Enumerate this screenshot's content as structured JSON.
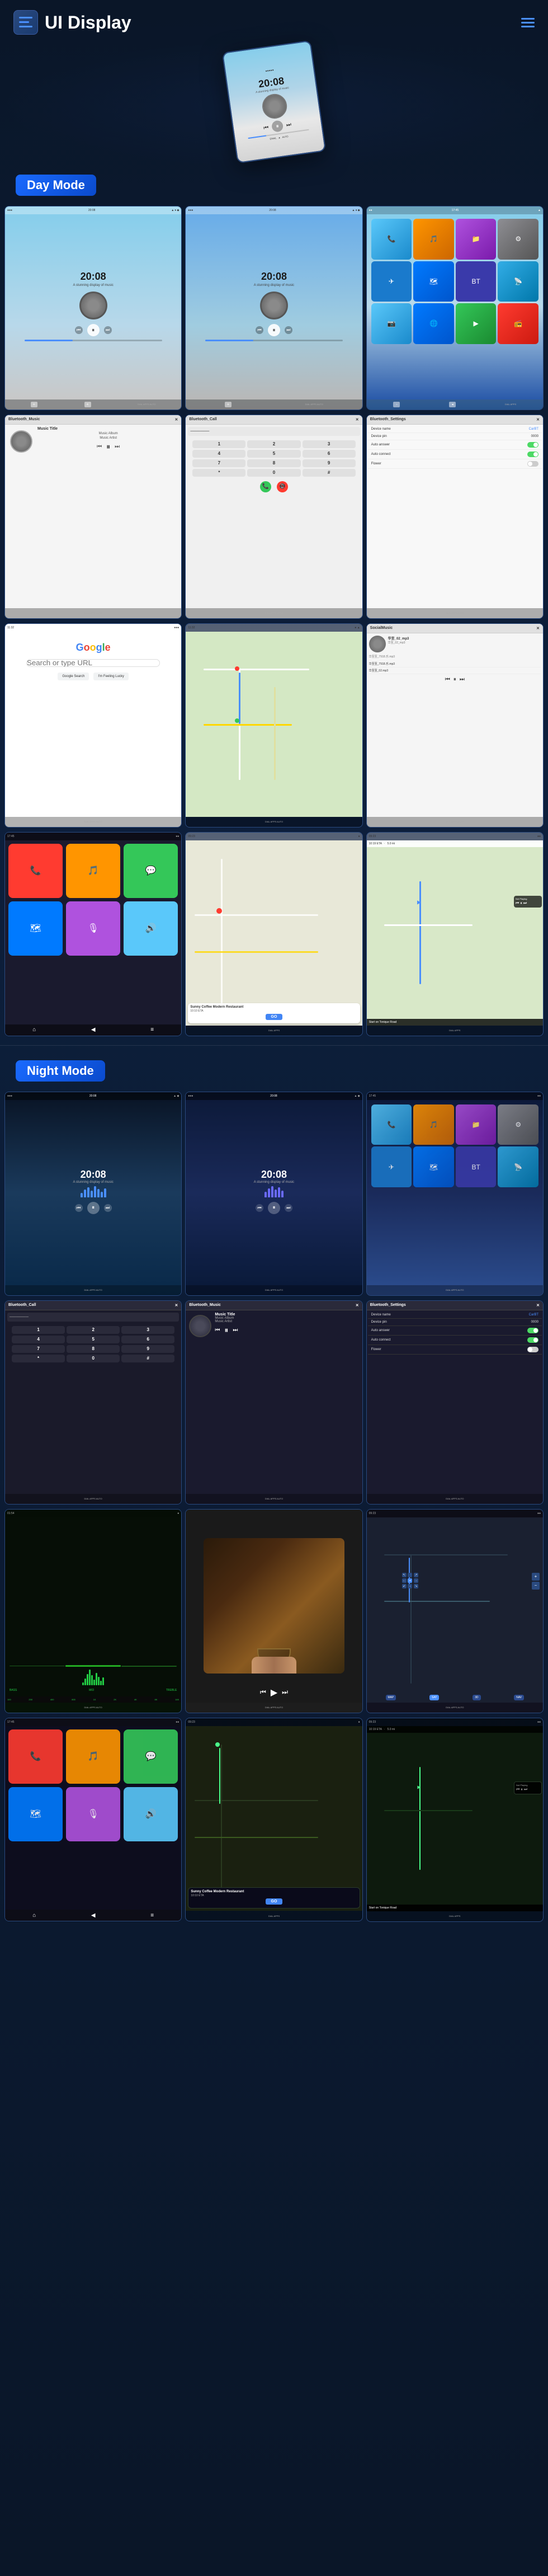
{
  "header": {
    "title": "UI Display",
    "menu_icon": "menu-icon",
    "dots_icon": "dots-icon"
  },
  "hero": {
    "time": "20:08",
    "subtitle": "A stunning display of music"
  },
  "sections": {
    "day_mode_label": "Day Mode",
    "night_mode_label": "Night Mode"
  },
  "day_mode": {
    "row1": [
      {
        "id": "music-day-1",
        "type": "music",
        "bg": "day_blue",
        "time": "20:08",
        "subtitle": "A stunning display of music"
      },
      {
        "id": "music-day-2",
        "type": "music",
        "bg": "day_blue2",
        "time": "20:08",
        "subtitle": "A stunning display of music"
      },
      {
        "id": "apps-day",
        "type": "apps",
        "bg": "day_apps"
      }
    ],
    "row2": [
      {
        "id": "bt-music",
        "type": "bt_music",
        "header": "Bluetooth_Music",
        "title": "Music Title",
        "album": "Music Album",
        "artist": "Music Artist"
      },
      {
        "id": "bt-call",
        "type": "bt_call",
        "header": "Bluetooth_Call"
      },
      {
        "id": "bt-settings",
        "type": "bt_settings",
        "header": "Bluetooth_Settings",
        "device_name_label": "Device name",
        "device_name_val": "CarBT",
        "device_pin_label": "Device pin",
        "device_pin_val": "0000",
        "auto_answer_label": "Auto answer",
        "auto_connect_label": "Auto connect",
        "flower_label": "Flower"
      }
    ],
    "row3": [
      {
        "id": "google",
        "type": "google"
      },
      {
        "id": "map-day",
        "type": "map"
      },
      {
        "id": "local-music",
        "type": "local_music"
      }
    ],
    "row4": [
      {
        "id": "carplay-apps",
        "type": "carplay_apps"
      },
      {
        "id": "nav-day",
        "type": "navigation",
        "restaurant": "Sunny Coffee Modern Restaurant",
        "distance": "10:10 ETA",
        "go_label": "GO"
      },
      {
        "id": "nav-map-day",
        "type": "nav_map",
        "eta": "10:19 ETA",
        "distance": "5.0 mi",
        "direction": "Start on Tonique Road",
        "now_playing": "Not Playing"
      }
    ]
  },
  "night_mode": {
    "row1": [
      {
        "id": "music-night-1",
        "type": "music_night",
        "time": "20:08",
        "subtitle": "A stunning display of music"
      },
      {
        "id": "music-night-2",
        "type": "music_night2",
        "time": "20:08",
        "subtitle": "A stunning display of music"
      },
      {
        "id": "apps-night",
        "type": "apps_night"
      }
    ],
    "row2": [
      {
        "id": "bt-call-night",
        "type": "bt_call_night",
        "header": "Bluetooth_Call"
      },
      {
        "id": "bt-music-night",
        "type": "bt_music_night",
        "header": "Bluetooth_Music",
        "title": "Music Title",
        "album": "Music Album",
        "artist": "Music Artist"
      },
      {
        "id": "bt-settings-night",
        "type": "bt_settings_night",
        "header": "Bluetooth_Settings",
        "device_name_label": "Device name",
        "device_name_val": "CarBT",
        "device_pin_label": "Device pin",
        "device_pin_val": "0000",
        "auto_answer_label": "Auto answer",
        "auto_connect_label": "Auto connect",
        "flower_label": "Flower"
      }
    ],
    "row3": [
      {
        "id": "green-wave",
        "type": "green_wave"
      },
      {
        "id": "hand-bowl",
        "type": "hand_bowl"
      },
      {
        "id": "dark-map",
        "type": "dark_map"
      }
    ],
    "row4": [
      {
        "id": "carplay-night",
        "type": "carplay_night"
      },
      {
        "id": "nav-night",
        "type": "nav_night",
        "restaurant": "Sunny Coffee Modern Restaurant",
        "distance": "10:10 ETA",
        "go_label": "GO"
      },
      {
        "id": "nav-map-night",
        "type": "nav_map_night",
        "eta": "10:19 ETA",
        "distance": "5.0 mi",
        "direction": "Start on Tonique Road",
        "now_playing": "Not Playing"
      }
    ]
  },
  "music_texts": {
    "title": "Music Title",
    "album": "Music Album",
    "artist": "Music Artist"
  },
  "bt_call_keys": [
    "1",
    "2",
    "3",
    "4",
    "5",
    "6",
    "7",
    "8",
    "9",
    "*",
    "0",
    "#"
  ],
  "colors": {
    "accent": "#4a8fff",
    "day_label_bg": "#1a6aff",
    "night_label_bg": "#1a6aff"
  }
}
